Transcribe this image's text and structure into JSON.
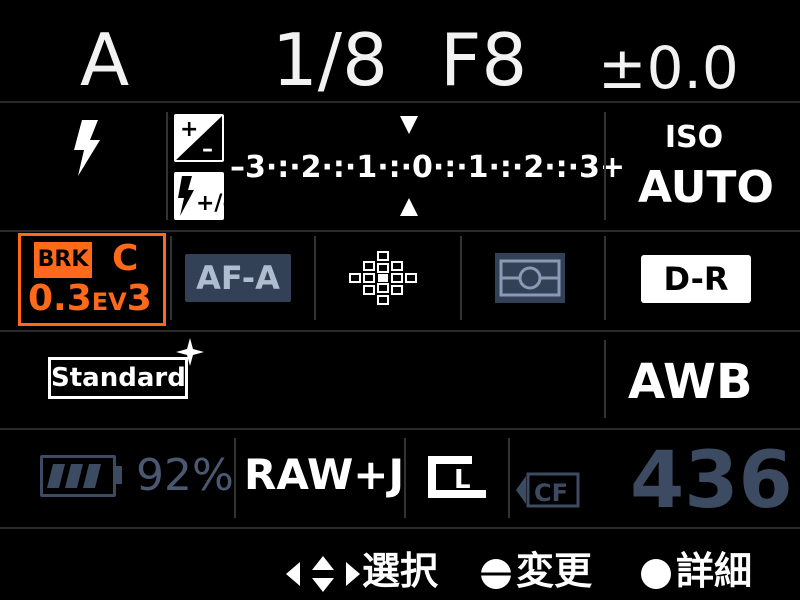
{
  "top": {
    "mode": "A",
    "shutter": "1/8",
    "aperture": "F8",
    "exposure_comp": "±0.0"
  },
  "row2": {
    "flash_icon": "flash-icon",
    "ev_icons": [
      "exposure-comp-icon",
      "flash-comp-icon"
    ],
    "scale": "–3·:·2·:·1·:·0·:·1·:·2·:·3+",
    "iso_label": "ISO",
    "iso_value": "AUTO"
  },
  "row3": {
    "bracket_label": "BRK",
    "bracket_mode": "C",
    "bracket_value": "0.3",
    "bracket_unit": "EV",
    "bracket_count": "3",
    "af_mode": "AF-A",
    "af_area_icon": "af-area-icon",
    "metering_icon": "metering-icon",
    "dro": "D-R"
  },
  "row4": {
    "creative_style": "Standard",
    "white_balance": "AWB"
  },
  "row5": {
    "battery_icon": "battery-icon",
    "battery_percent": "92%",
    "quality": "RAW+J",
    "image_size": "L",
    "media_icon": "cf-card-icon",
    "media_label": "CF",
    "shots_remaining": "436"
  },
  "help": {
    "select_label": "選択",
    "change_label": "変更",
    "details_label": "詳細"
  },
  "colors": {
    "accent": "#ff6a1a",
    "dim": "#3c4a62",
    "highlight_bg": "#334157"
  }
}
